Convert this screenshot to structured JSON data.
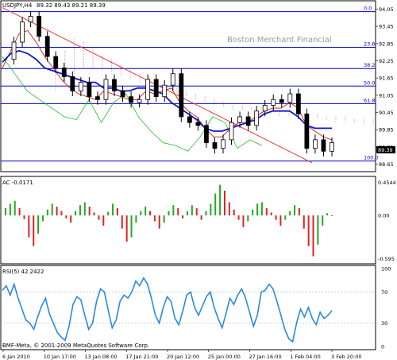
{
  "colors": {
    "background": "#ffffff",
    "frame": "#000000",
    "fibo": "#0000cc",
    "ma_blue": "#1515c8",
    "ma_red": "#d81818",
    "trend": "#e83a3a",
    "chikou": "#22bb22",
    "kumo": "#c05070",
    "ac_up": "#22aa22",
    "ac_down": "#dd2222",
    "rsi": "#2a8ae0",
    "rsi_level": "#b0b0b0"
  },
  "chart_data": [
    {
      "type": "candlestick",
      "title": "USDJPY,H4",
      "ohlc_label": "89.32 89.43 89.21 89.39",
      "watermark": "Boston Merchant Financial",
      "current_price": "89.39",
      "y_ticks": [
        "94.05",
        "93.45",
        "92.85",
        "92.25",
        "91.65",
        "91.05",
        "90.45",
        "89.85",
        "89.25",
        "88.65"
      ],
      "ylim": [
        88.5,
        94.2
      ],
      "fib_levels": [
        {
          "label": "0.0",
          "value": 93.96
        },
        {
          "label": "23.6",
          "value": 92.72
        },
        {
          "label": "38.2",
          "value": 91.98
        },
        {
          "label": "50.0",
          "value": 91.37
        },
        {
          "label": "61.8",
          "value": 90.76
        },
        {
          "label": "100.0",
          "value": 88.76
        }
      ],
      "trend_line": {
        "x": [
          0,
          390
        ],
        "y": [
          94.1,
          88.7
        ]
      },
      "close_series": [
        92.3,
        92.9,
        93.6,
        93.8,
        93.1,
        92.4,
        92.0,
        91.7,
        91.2,
        91.5,
        91.0,
        90.9,
        91.6,
        91.2,
        91.0,
        90.8,
        90.9,
        91.6,
        91.0,
        91.4,
        91.8,
        90.3,
        90.1,
        90.0,
        89.4,
        89.2,
        89.5,
        90.1,
        90.3,
        90.0,
        90.5,
        90.7,
        90.9,
        90.8,
        91.1,
        90.4,
        89.2,
        89.5,
        89.1,
        89.4
      ],
      "ma_blue": [
        92.2,
        92.5,
        92.6,
        92.5,
        92.3,
        92.0,
        91.9,
        91.8,
        91.7,
        91.6,
        91.5,
        91.5,
        91.3,
        91.3,
        91.2,
        91.2,
        91.3,
        91.3,
        91.2,
        91.1,
        90.8,
        90.6,
        90.4,
        90.2,
        89.9,
        89.8,
        89.8,
        89.9,
        90.0,
        90.1,
        90.2,
        90.4,
        90.5,
        90.5,
        90.5,
        90.3,
        90.0,
        89.9,
        89.9,
        89.9
      ],
      "ma_red": [
        92.0,
        92.6,
        93.2,
        93.3,
        92.9,
        92.4,
        92.0,
        91.6,
        91.3,
        91.1,
        91.0,
        90.9,
        91.2,
        91.1,
        91.0,
        90.9,
        90.9,
        91.2,
        91.1,
        91.2,
        91.3,
        90.8,
        90.5,
        90.3,
        89.9,
        89.6,
        89.6,
        89.9,
        90.1,
        90.1,
        90.3,
        90.5,
        90.6,
        90.6,
        90.8,
        90.6,
        90.0,
        89.8,
        89.6,
        89.5
      ],
      "chikou": [
        92.4,
        91.8,
        91.2,
        90.9,
        90.6,
        90.3,
        90.2,
        90.9,
        90.1,
        90.8,
        91.1,
        90.3,
        89.8,
        89.4,
        89.3,
        89.1,
        89.6,
        90.3,
        90.1,
        89.2,
        89.5,
        89.3
      ],
      "kumo_top": [
        91.8,
        92.6,
        93.0,
        92.9,
        92.7,
        92.4,
        92.3,
        92.1,
        91.9,
        91.8,
        91.7,
        91.6,
        91.4,
        91.3,
        91.2,
        91.1,
        91.0,
        90.9,
        90.8,
        90.7,
        90.7,
        90.6,
        90.6,
        90.5,
        90.5,
        90.5,
        90.4,
        90.4,
        90.4,
        90.3,
        90.3,
        90.3,
        90.2,
        90.2,
        90.2
      ],
      "kumo_bottom": [
        91.2,
        91.5,
        91.8,
        92.0,
        92.0,
        91.9,
        91.8,
        91.7,
        91.6,
        91.5,
        91.4,
        91.3,
        91.2,
        91.1,
        91.0,
        90.9,
        90.8,
        90.7,
        90.6,
        90.5,
        90.5,
        90.5,
        90.4,
        90.4,
        90.3,
        90.3,
        90.3,
        90.2,
        90.2,
        90.2,
        90.1,
        90.1,
        90.1,
        90.0,
        90.0
      ]
    },
    {
      "type": "bar",
      "title": "AC -0.0171",
      "y_ticks": [
        "0.4544",
        "0.00",
        "-0.595"
      ],
      "ylim": [
        -0.62,
        0.48
      ],
      "values": [
        0.1,
        0.16,
        0.2,
        0.1,
        -0.05,
        -0.3,
        -0.42,
        -0.25,
        -0.08,
        0.08,
        0.16,
        0.12,
        0.06,
        -0.04,
        -0.1,
        0.06,
        0.14,
        0.18,
        0.12,
        0.04,
        -0.06,
        -0.14,
        0.05,
        0.16,
        0.1,
        -0.18,
        -0.36,
        -0.3,
        -0.1,
        0.06,
        0.12,
        0.06,
        -0.08,
        -0.18,
        -0.1,
        0.06,
        0.14,
        0.1,
        -0.04,
        0.06,
        0.14,
        0.1,
        -0.06,
        0.06,
        0.16,
        0.3,
        0.42,
        0.34,
        0.18,
        0.08,
        -0.06,
        -0.16,
        -0.08,
        0.08,
        0.16,
        0.18,
        0.1,
        0.04,
        -0.06,
        -0.14,
        -0.06,
        0.06,
        0.14,
        0.1,
        -0.18,
        -0.42,
        -0.56,
        -0.4,
        -0.14,
        0.03,
        -0.01
      ]
    },
    {
      "type": "line",
      "title": "RSI(5) 42.2422",
      "y_ticks": [
        "100",
        "70",
        "30",
        "0"
      ],
      "levels": [
        70,
        30
      ],
      "ylim": [
        0,
        100
      ],
      "values": [
        72,
        78,
        66,
        80,
        62,
        48,
        34,
        30,
        22,
        38,
        52,
        62,
        42,
        30,
        18,
        12,
        8,
        26,
        54,
        64,
        60,
        40,
        22,
        30,
        58,
        74,
        70,
        46,
        24,
        34,
        58,
        66,
        62,
        70,
        84,
        78,
        88,
        80,
        62,
        40,
        30,
        50,
        64,
        58,
        36,
        28,
        46,
        66,
        70,
        50,
        40,
        52,
        64,
        70,
        50,
        36,
        24,
        42,
        62,
        54,
        66,
        74,
        62,
        44,
        26,
        40,
        70,
        72,
        80,
        74,
        58,
        40,
        22,
        10,
        6,
        30,
        48,
        38,
        50,
        36,
        28,
        44,
        36,
        40,
        46
      ],
      "x_ticks": [
        "6 Jan 2010",
        "10 Jan 17:00",
        "13 Jan 08:00",
        "17 Jan 21:00",
        "20 Jan 12:00",
        "25 Jan 00:00",
        "27 Jan 16:00",
        "1 Feb 04:00",
        "3 Feb 20:00"
      ],
      "copyright": "BMF-Meta, © 2001-2009 MetaQuotes Software Corp."
    }
  ]
}
